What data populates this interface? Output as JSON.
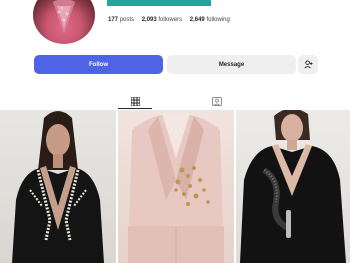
{
  "profile": {
    "stats": {
      "posts_value": "177",
      "posts_label": "posts",
      "followers_value": "2,093",
      "followers_label": "followers",
      "following_value": "2,649",
      "following_label": "following"
    }
  },
  "actions": {
    "follow_label": "Follow",
    "message_label": "Message"
  },
  "tabs": [
    {
      "name": "posts-grid",
      "icon": "grid-icon",
      "active": true
    },
    {
      "name": "tagged",
      "icon": "tagged-icon",
      "active": false
    }
  ],
  "colors": {
    "follow_button": "#4f63e6",
    "teal_accent": "#1fa6a0"
  },
  "posts": [
    {
      "icon": "black-embellished-blazer-photo"
    },
    {
      "icon": "blush-pink-embroidered-suit-photo"
    },
    {
      "icon": "black-beaded-blazer-photo"
    }
  ]
}
